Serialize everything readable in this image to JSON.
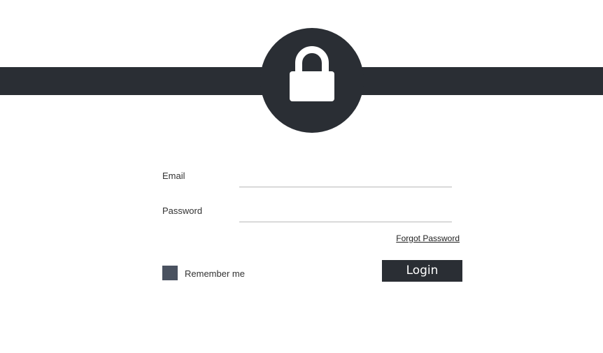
{
  "header": {
    "lock_icon": "lock-icon",
    "band_color": "#2a2e34"
  },
  "form": {
    "email_label": "Email",
    "email_value": "",
    "email_placeholder": "",
    "password_label": "Password",
    "password_value": "",
    "password_placeholder": "",
    "forgot_password_label": "Forgot Password",
    "remember_label": "Remember me",
    "remember_checked": false,
    "login_label": "Login"
  },
  "colors": {
    "accent": "#2a2e34",
    "checkbox": "#4a5260",
    "background": "#ffffff"
  }
}
